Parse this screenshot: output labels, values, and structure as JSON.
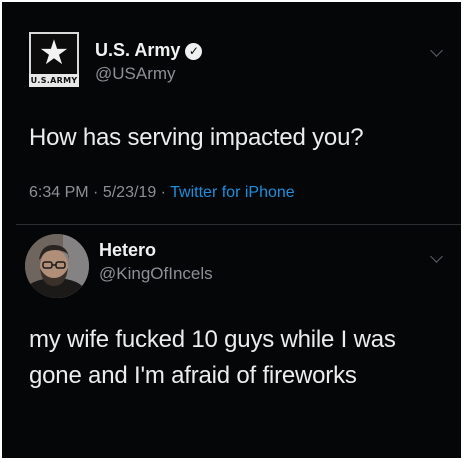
{
  "tweet": {
    "name": "U.S. Army",
    "handle": "@USArmy",
    "avatar_label": "U.S.ARMY",
    "verified": true,
    "text": "How has serving impacted you?",
    "time": "6:34 PM",
    "date": "5/23/19",
    "separator": "·",
    "source": "Twitter for iPhone"
  },
  "reply": {
    "name": "Hetero",
    "handle": "@KingOfIncels",
    "text_lines": [
      "my wife fucked 10 guys while I was",
      "gone and I'm afraid of fireworks"
    ]
  },
  "colors": {
    "background": "#050607",
    "text": "#ececec",
    "muted": "#8a9096",
    "link": "#1d8fe0"
  }
}
